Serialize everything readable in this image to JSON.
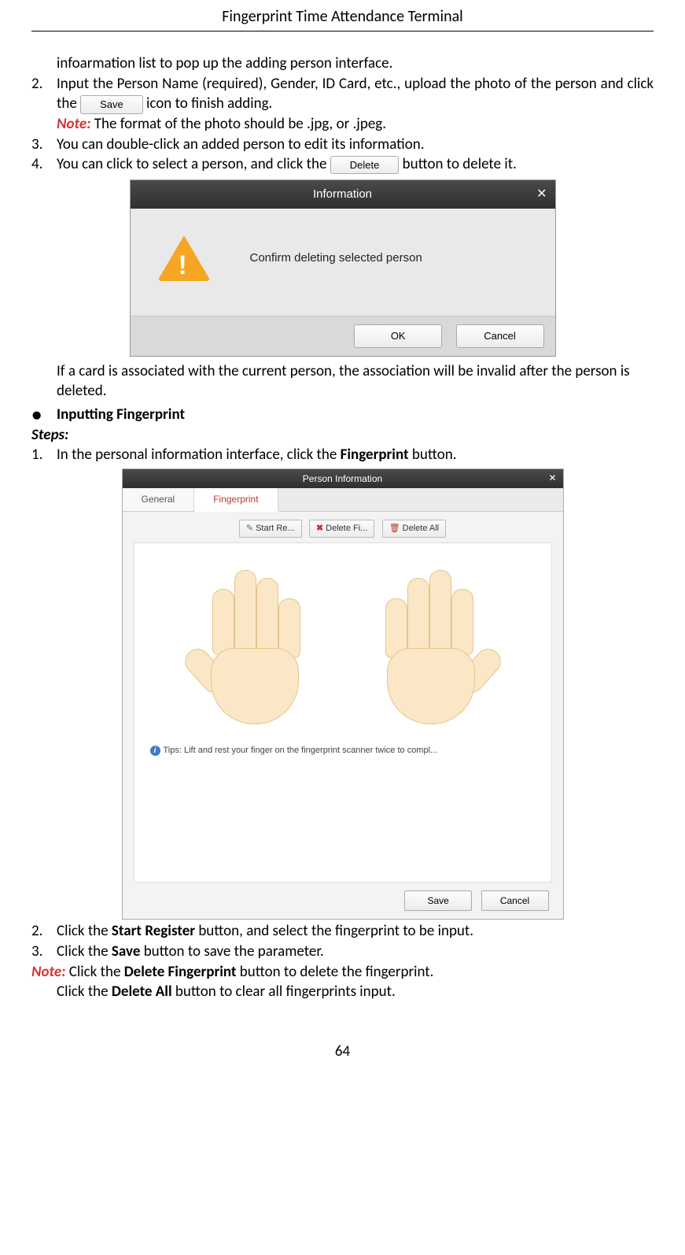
{
  "header": {
    "title": "Fingerprint Time Attendance Terminal"
  },
  "para_intro": "infoarmation list to pop up the adding person interface.",
  "item2": {
    "num": "2.",
    "pre": "Input the Person Name (required), Gender, ID Card, etc., upload the photo of the person and click the ",
    "btn": "Save",
    "post": " icon to finish adding."
  },
  "note1": {
    "label": "Note:",
    "text": " The format of the photo should be .jpg, or .jpeg."
  },
  "item3": {
    "num": "3.",
    "text": "You can double-click an added person to edit its information."
  },
  "item4": {
    "num": "4.",
    "pre": "You can click to select a person, and click the ",
    "btn": "Delete",
    "post": " button to delete it."
  },
  "dialog1": {
    "title": "Information",
    "msg": "Confirm deleting selected person",
    "ok": "OK",
    "cancel": "Cancel"
  },
  "after_dlg1": "If a card is associated with the current person, the association will be invalid after the person is deleted.",
  "section": {
    "bullet": "●",
    "title": "Inputting Fingerprint"
  },
  "steps_label": "Steps:",
  "fp_item1": {
    "num": "1.",
    "pre": "In the personal information interface, click the ",
    "bold": "Fingerprint",
    "post": " button."
  },
  "dialog2": {
    "title": "Person Information",
    "tabs": {
      "general": "General",
      "fingerprint": "Fingerprint"
    },
    "toolbar": {
      "start": "Start Re...",
      "deletefi": "Delete Fi...",
      "deleteall": "Delete All"
    },
    "tips": "Tips: Lift and rest your finger on the fingerprint scanner twice to compl...",
    "save": "Save",
    "cancel": "Cancel"
  },
  "fp_item2": {
    "num": "2.",
    "pre": "Click the ",
    "bold": "Start Register",
    "post": " button, and select the fingerprint to be input."
  },
  "fp_item3": {
    "num": "3.",
    "pre": "Click the ",
    "bold": "Save",
    "post": " button to save the parameter."
  },
  "note2": {
    "label": "Note:",
    "line1_pre": " Click the ",
    "line1_bold": "Delete Fingerprint",
    "line1_post": " button to delete the fingerprint.",
    "line2_pre": "Click the ",
    "line2_bold": "Delete All",
    "line2_post": " button to clear all fingerprints input."
  },
  "page_number": "64"
}
